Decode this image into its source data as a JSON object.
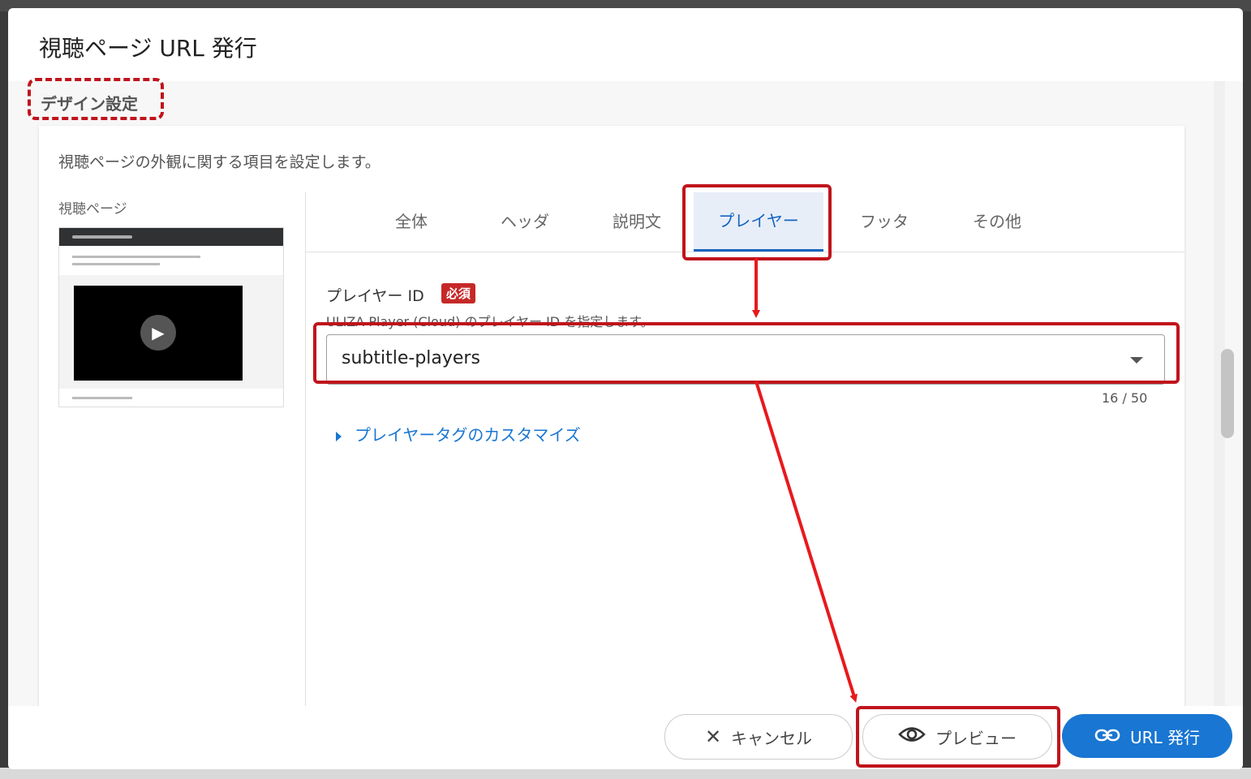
{
  "dialog": {
    "title": "視聴ページ URL 発行",
    "section_label": "デザイン設定",
    "description": "視聴ページの外観に関する項目を設定します。",
    "preview_label": "視聴ページ"
  },
  "tabs": [
    {
      "label": "全体",
      "active": false
    },
    {
      "label": "ヘッダ",
      "active": false
    },
    {
      "label": "説明文",
      "active": false
    },
    {
      "label": "プレイヤー",
      "active": true
    },
    {
      "label": "フッタ",
      "active": false
    },
    {
      "label": "その他",
      "active": false
    }
  ],
  "player_field": {
    "label": "プレイヤー ID",
    "required_badge": "必須",
    "help": "ULIZA Player (Cloud) のプレイヤー ID を指定します。",
    "value": "subtitle-players",
    "char_count": "16 / 50"
  },
  "expander": {
    "label": "プレイヤータグのカスタマイズ"
  },
  "footer": {
    "cancel_label": "キャンセル",
    "preview_label": "プレビュー",
    "issue_label": "URL 発行"
  },
  "colors": {
    "accent": "#1976d2",
    "required": "#c62828",
    "annotation": "#c0141c",
    "arrow": "#e8191d"
  }
}
